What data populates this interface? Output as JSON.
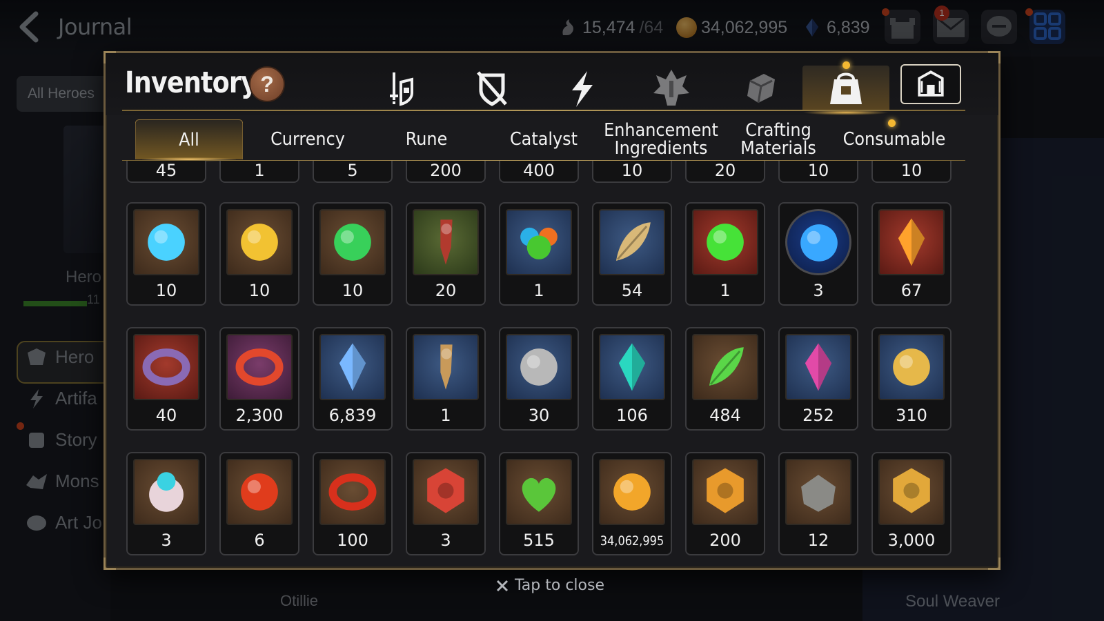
{
  "background": {
    "title": "Journal",
    "resources": [
      {
        "name": "stamina",
        "value": "15,474",
        "max": "/64",
        "icon": "stamina-icon"
      },
      {
        "name": "gold",
        "value": "34,062,995",
        "icon": "gold-coin-icon"
      },
      {
        "name": "crystal",
        "value": "6,839",
        "icon": "crystal-icon"
      }
    ],
    "mail_badge": "1",
    "all_heroes": "All Heroes",
    "hero_label": "Hero",
    "hero_level": "11",
    "sidebar": [
      "Hero",
      "Artifa",
      "Story",
      "Mons",
      "Art Jo"
    ],
    "hero_name": "Otillie",
    "right_label": "Soul Weaver"
  },
  "modal": {
    "title": "Inventory",
    "help": "?",
    "category_tabs": [
      {
        "name": "equipment-tab",
        "icon": "sword-shield-icon"
      },
      {
        "name": "broken-equipment-tab",
        "icon": "broken-shield-icon"
      },
      {
        "name": "artifact-tab",
        "icon": "lightning-icon"
      },
      {
        "name": "exclusive-tab",
        "icon": "crest-icon"
      },
      {
        "name": "material-tab",
        "icon": "cube-icon"
      },
      {
        "name": "items-tab",
        "icon": "bag-icon",
        "active": true
      }
    ],
    "sub_tabs": [
      {
        "label": "All",
        "active": true
      },
      {
        "label": "Currency"
      },
      {
        "label": "Rune"
      },
      {
        "label": "Catalyst"
      },
      {
        "label": "Enhancement Ingredients"
      },
      {
        "label": "Crafting Materials"
      },
      {
        "label": "Consumable"
      }
    ],
    "partial_row": [
      "45",
      "1",
      "5",
      "200",
      "400",
      "10",
      "20",
      "10",
      "10"
    ],
    "rows": [
      [
        {
          "qty": "10",
          "icon": "blue-rune-icon",
          "frame": "plain"
        },
        {
          "qty": "10",
          "icon": "gold-rune-icon",
          "frame": "plain"
        },
        {
          "qty": "10",
          "icon": "green-rune-icon",
          "frame": "plain"
        },
        {
          "qty": "20",
          "icon": "claw-icon",
          "frame": "green"
        },
        {
          "qty": "1",
          "icon": "slime-orbs-icon",
          "frame": "blue"
        },
        {
          "qty": "54",
          "icon": "feather-root-icon",
          "frame": "blue"
        },
        {
          "qty": "1",
          "icon": "green-potion-icon",
          "frame": "red"
        },
        {
          "qty": "3",
          "icon": "blue-sigil-icon",
          "frame": "round"
        },
        {
          "qty": "67",
          "icon": "fire-crystal-icon",
          "frame": "red"
        }
      ],
      [
        {
          "qty": "40",
          "icon": "ring-charm-icon",
          "frame": "red"
        },
        {
          "qty": "2,300",
          "icon": "red-ring-icon",
          "frame": "purple"
        },
        {
          "qty": "6,839",
          "icon": "blue-gem-icon",
          "frame": "blue"
        },
        {
          "qty": "1",
          "icon": "pendant-icon",
          "frame": "blue"
        },
        {
          "qty": "30",
          "icon": "silver-coin-icon",
          "frame": "blue"
        },
        {
          "qty": "106",
          "icon": "teal-crystal-icon",
          "frame": "blue"
        },
        {
          "qty": "484",
          "icon": "leaf-icon",
          "frame": "plain"
        },
        {
          "qty": "252",
          "icon": "pink-crystal-icon",
          "frame": "blue"
        },
        {
          "qty": "310",
          "icon": "star-amulet-icon",
          "frame": "blue"
        }
      ],
      [
        {
          "qty": "3",
          "icon": "robot-icon",
          "frame": "plain"
        },
        {
          "qty": "6",
          "icon": "fire-orb-icon",
          "frame": "plain"
        },
        {
          "qty": "100",
          "icon": "red-band-icon",
          "frame": "plain"
        },
        {
          "qty": "3",
          "icon": "seal-icon",
          "frame": "plain"
        },
        {
          "qty": "515",
          "icon": "green-heart-icon",
          "frame": "plain"
        },
        {
          "qty": "34,062,995",
          "icon": "gold-coin-icon",
          "frame": "plain"
        },
        {
          "qty": "200",
          "icon": "gold-hex-icon",
          "frame": "plain"
        },
        {
          "qty": "12",
          "icon": "stone-icon",
          "frame": "plain"
        },
        {
          "qty": "3,000",
          "icon": "fist-emblem-icon",
          "frame": "plain"
        }
      ]
    ],
    "close_hint": "Tap to close",
    "colors": {
      "gold_accent": "#b59a5a",
      "frame_border": "#6b5a3d"
    }
  }
}
